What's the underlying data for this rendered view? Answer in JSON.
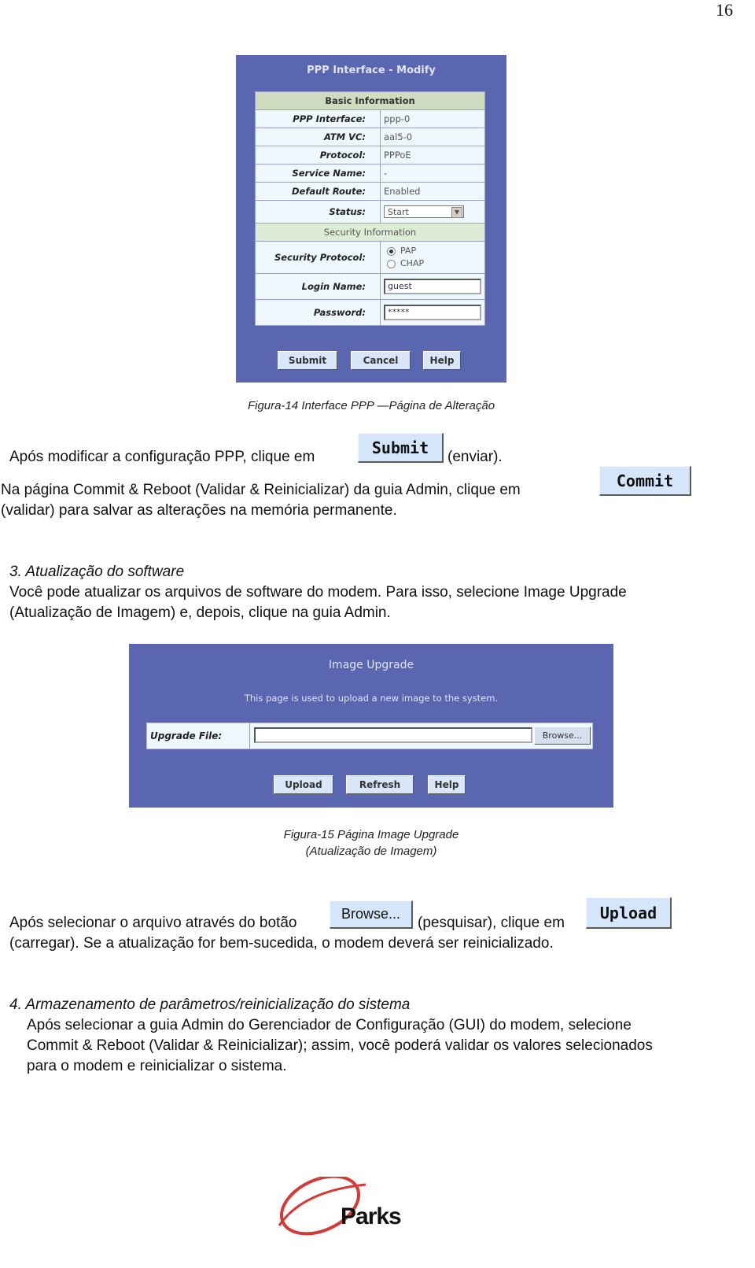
{
  "page_number": "16",
  "figure14": {
    "title": "PPP Interface - Modify",
    "section_basic": "Basic Information",
    "fields": [
      {
        "label": "PPP Interface:",
        "value": "ppp-0"
      },
      {
        "label": "ATM VC:",
        "value": "aal5-0"
      },
      {
        "label": "Protocol:",
        "value": "PPPoE"
      },
      {
        "label": "Service Name:",
        "value": "-"
      },
      {
        "label": "Default Route:",
        "value": "Enabled"
      }
    ],
    "status_label": "Status:",
    "status_value": "Start",
    "section_security": "Security Information",
    "security_protocol_label": "Security Protocol:",
    "security_options": [
      {
        "label": "PAP",
        "selected": true
      },
      {
        "label": "CHAP",
        "selected": false
      }
    ],
    "login_label": "Login Name:",
    "login_value": "guest",
    "password_label": "Password:",
    "password_value": "*****",
    "buttons": {
      "submit": "Submit",
      "cancel": "Cancel",
      "help": "Help"
    },
    "caption": "Figura-14 Interface PPP —Página de Alteração"
  },
  "para1": {
    "text_before": "Após modificar a configuração PPP, clique em",
    "button": "Submit",
    "text_after": "(enviar)."
  },
  "para2": {
    "line1": "Na página Commit & Reboot (Validar & Reinicializar) da guia Admin, clique em",
    "button": "Commit",
    "line2": "(validar) para salvar as alterações na memória permanente."
  },
  "section3": {
    "heading": "3. Atualização do software",
    "line1": "Você pode atualizar os arquivos de software do modem. Para isso, selecione Image Upgrade",
    "line2": "(Atualização de Imagem) e, depois, clique na guia Admin."
  },
  "figure15": {
    "title": "Image Upgrade",
    "description": "This page is used to upload a new image to the system.",
    "file_label": "Upgrade File:",
    "file_value": "",
    "browse": "Browse...",
    "buttons": {
      "upload": "Upload",
      "refresh": "Refresh",
      "help": "Help"
    },
    "caption_line1": "Figura-15 Página Image Upgrade",
    "caption_line2": "(Atualização de Imagem)"
  },
  "para3": {
    "text_before": "Após selecionar o arquivo através do botão",
    "browse_button": "Browse...",
    "text_middle": "(pesquisar), clique em",
    "upload_button": "Upload",
    "line2": "(carregar). Se a atualização for bem-sucedida, o modem deverá ser reinicializado."
  },
  "section4": {
    "heading": "4. Armazenamento de parâmetros/reinicialização do sistema",
    "line1": "Após selecionar a guia Admin do Gerenciador de Configuração (GUI) do modem, selecione",
    "line2": "Commit & Reboot (Validar & Reinicializar); assim, você poderá validar os valores selecionados",
    "line3": "para o modem e reinicializar o sistema."
  },
  "logo": {
    "text": "Parks",
    "accent_color": "#d63a35"
  },
  "colors": {
    "panel": "#5b66b0",
    "section_header": "#cfdcc0",
    "row_bg": "#eef8fc",
    "button": "#d6e6fa"
  }
}
